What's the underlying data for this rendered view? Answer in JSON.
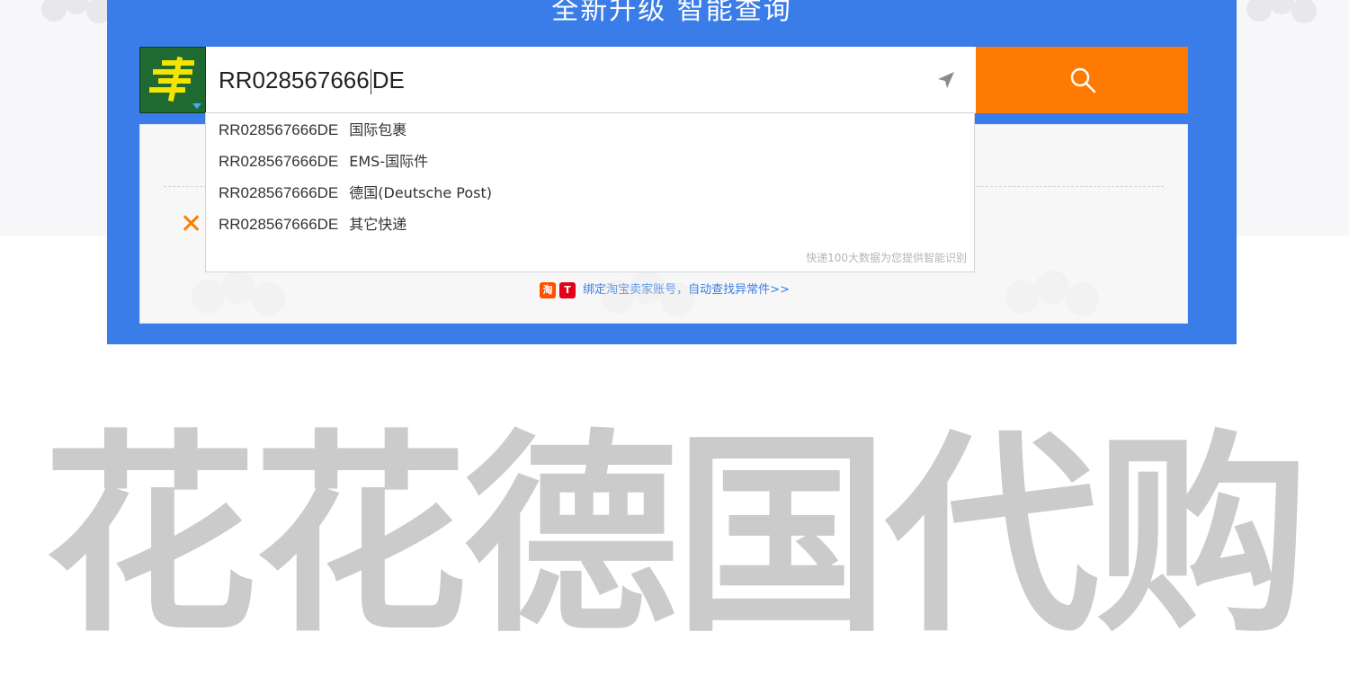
{
  "header": {
    "title": "全新升级 智能查询"
  },
  "search": {
    "value": "RR028567666",
    "value_after_cursor": "DE",
    "carrier_logo_icon": "china-post-logo-icon",
    "locate_icon": "location-arrow-icon",
    "search_icon": "magnifier-icon"
  },
  "suggestions": {
    "items": [
      {
        "code": "RR028567666DE",
        "carrier": "国际包裹"
      },
      {
        "code": "RR028567666DE",
        "carrier": "EMS-国际件"
      },
      {
        "code": "RR028567666DE",
        "carrier": "德国(Deutsche Post)"
      },
      {
        "code": "RR028567666DE",
        "carrier": "其它快递"
      }
    ],
    "footnote": "快递100大数据为您提供智能识别"
  },
  "result_card": {
    "error_icon": "close-x-icon",
    "taobao_icon_text": "淘",
    "tmall_icon_text": "T",
    "bind_link": "绑定淘宝卖家账号，自动查找异常件>>"
  },
  "banner": {
    "text": "花花德国代购"
  },
  "colors": {
    "panel_blue": "#3a7de8",
    "search_orange": "#ff7a00",
    "logo_green": "#1f6a32",
    "logo_yellow": "#f5e400",
    "banner_gray": "#cbcbcb"
  }
}
